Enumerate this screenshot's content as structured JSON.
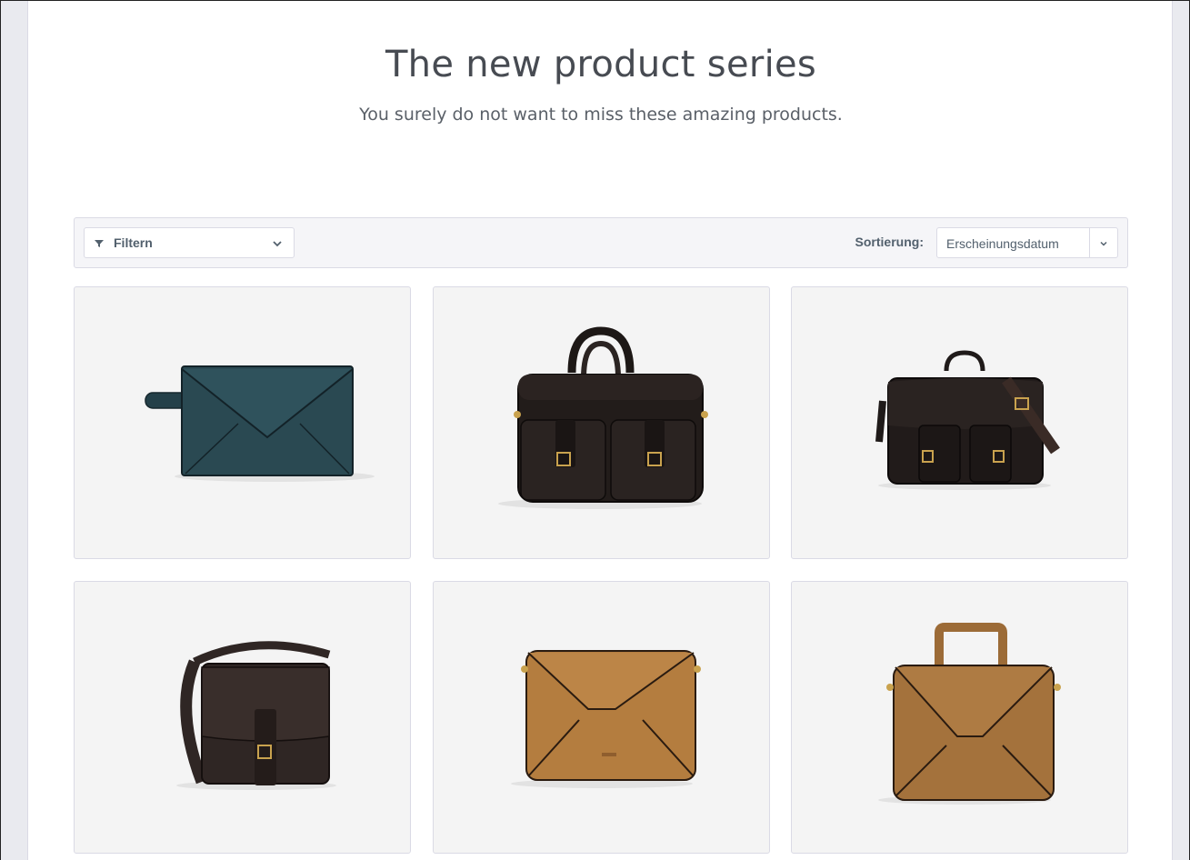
{
  "hero": {
    "title": "The new product series",
    "subtitle": "You surely do not want to miss these amazing products."
  },
  "action_bar": {
    "filter_label": "Filtern",
    "filter_icon": "filter-icon",
    "sort_label": "Sortierung:",
    "sort_value": "Erscheinungsdatum"
  },
  "colors": {
    "page_background": "#e9eaef",
    "card_background": "#f4f4f4",
    "border": "#dadae5",
    "text": "#52606d"
  },
  "products": [
    {
      "image": "teal-envelope-clutch-bag",
      "color": "#233c44"
    },
    {
      "image": "black-leather-briefcase",
      "color": "#211c1b"
    },
    {
      "image": "black-leather-satchel",
      "color": "#1f1a1a"
    },
    {
      "image": "dark-brown-messenger-bag",
      "color": "#2e2523"
    },
    {
      "image": "tan-envelope-messenger-bag",
      "color": "#b07a3c"
    },
    {
      "image": "tan-handle-envelope-bag",
      "color": "#9a6a35"
    }
  ]
}
